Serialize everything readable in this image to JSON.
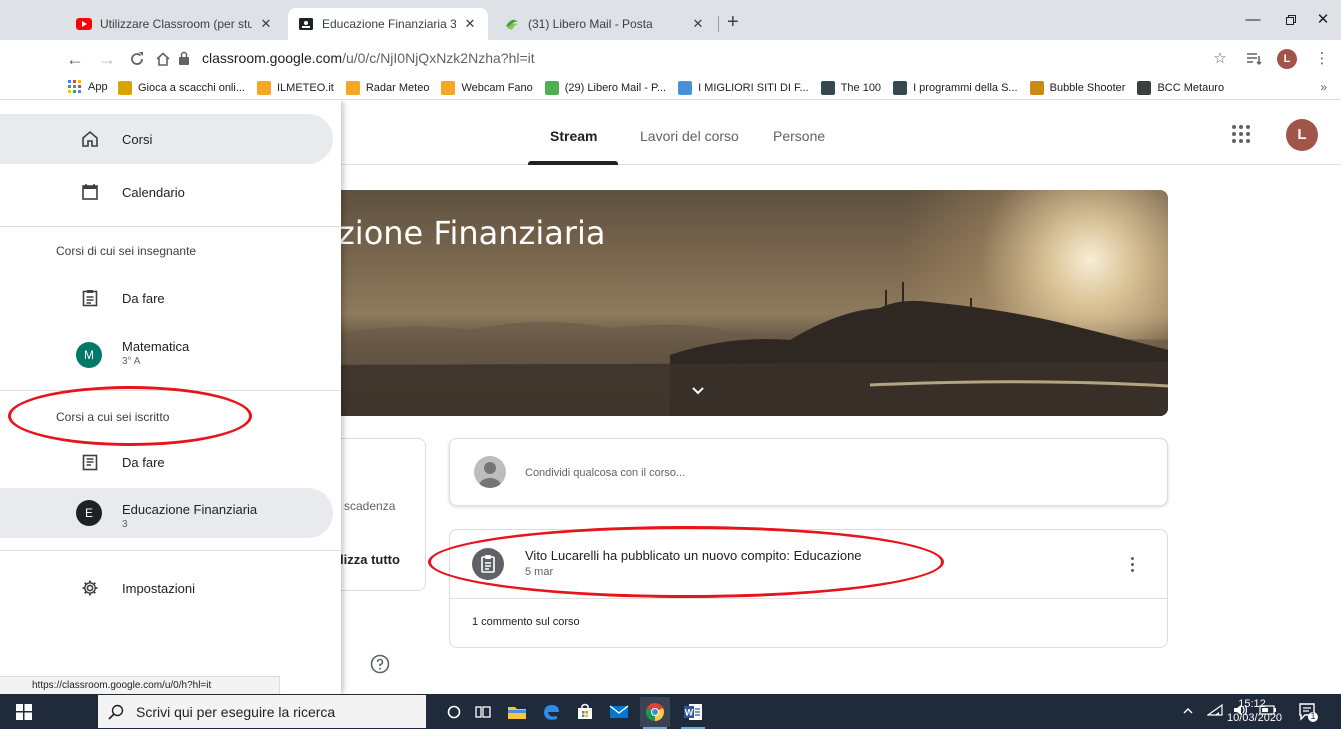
{
  "browser": {
    "tabs": [
      {
        "title": "Utilizzare Classroom (per studenti",
        "close": "✕"
      },
      {
        "title": "Educazione Finanziaria 3",
        "close": "✕"
      },
      {
        "title": "(31) Libero Mail - Posta",
        "close": "✕"
      }
    ],
    "new_tab": "+",
    "url_host": "classroom.google.com",
    "url_rest": "/u/0/c/NjI0NjQxNzk2Nzha?hl=it",
    "profile_initial": "L",
    "bookmarks": [
      {
        "label": "Gioca a scacchi onli...",
        "color": "#d9a400"
      },
      {
        "label": "ILMETEO.it",
        "color": "#f5a623"
      },
      {
        "label": "Radar Meteo",
        "color": "#f5a623"
      },
      {
        "label": "Webcam Fano",
        "color": "#f5a623"
      },
      {
        "label": "(29) Libero Mail - P...",
        "color": "#4caf50"
      },
      {
        "label": "I MIGLIORI SITI DI F...",
        "color": "#4a90d9"
      },
      {
        "label": "The 100",
        "color": "#37474f"
      },
      {
        "label": "I programmi della S...",
        "color": "#37474f"
      },
      {
        "label": "Bubble Shooter",
        "color": "#c98b14"
      },
      {
        "label": "BCC Metauro",
        "color": "#3c4043"
      }
    ],
    "apps_label": "App",
    "more": "»",
    "status_url": "https://classroom.google.com/u/0/h?hl=it"
  },
  "classroom": {
    "tabs": [
      "Stream",
      "Lavori del corso",
      "Persone"
    ],
    "avatar_initial": "L",
    "banner_title": "zione Finanziaria",
    "upcoming_due": "scadenza",
    "upcoming_view_all": "lizza tutto",
    "share_placeholder": "Condividi qualcosa con il corso...",
    "post": {
      "title": "Vito Lucarelli ha pubblicato un nuovo compito: Educazione",
      "date": "5 mar",
      "comments": "1 commento sul corso"
    }
  },
  "drawer": {
    "classes": "Corsi",
    "calendar": "Calendario",
    "teaching_section": "Corsi di cui sei insegnante",
    "teaching_todo": "Da fare",
    "teaching_course": {
      "name": "Matematica",
      "section": "3° A",
      "initial": "M",
      "color": "#00796b"
    },
    "enrolled_section": "Corsi a cui sei iscritto",
    "enrolled_todo": "Da fare",
    "enrolled_course": {
      "name": "Educazione Finanziaria",
      "section": "3",
      "initial": "E",
      "color": "#202124"
    },
    "settings": "Impostazioni"
  },
  "taskbar": {
    "search_placeholder": "Scrivi qui per eseguire la ricerca",
    "time": "15:12",
    "date": "10/03/2020",
    "notifications": "1"
  }
}
